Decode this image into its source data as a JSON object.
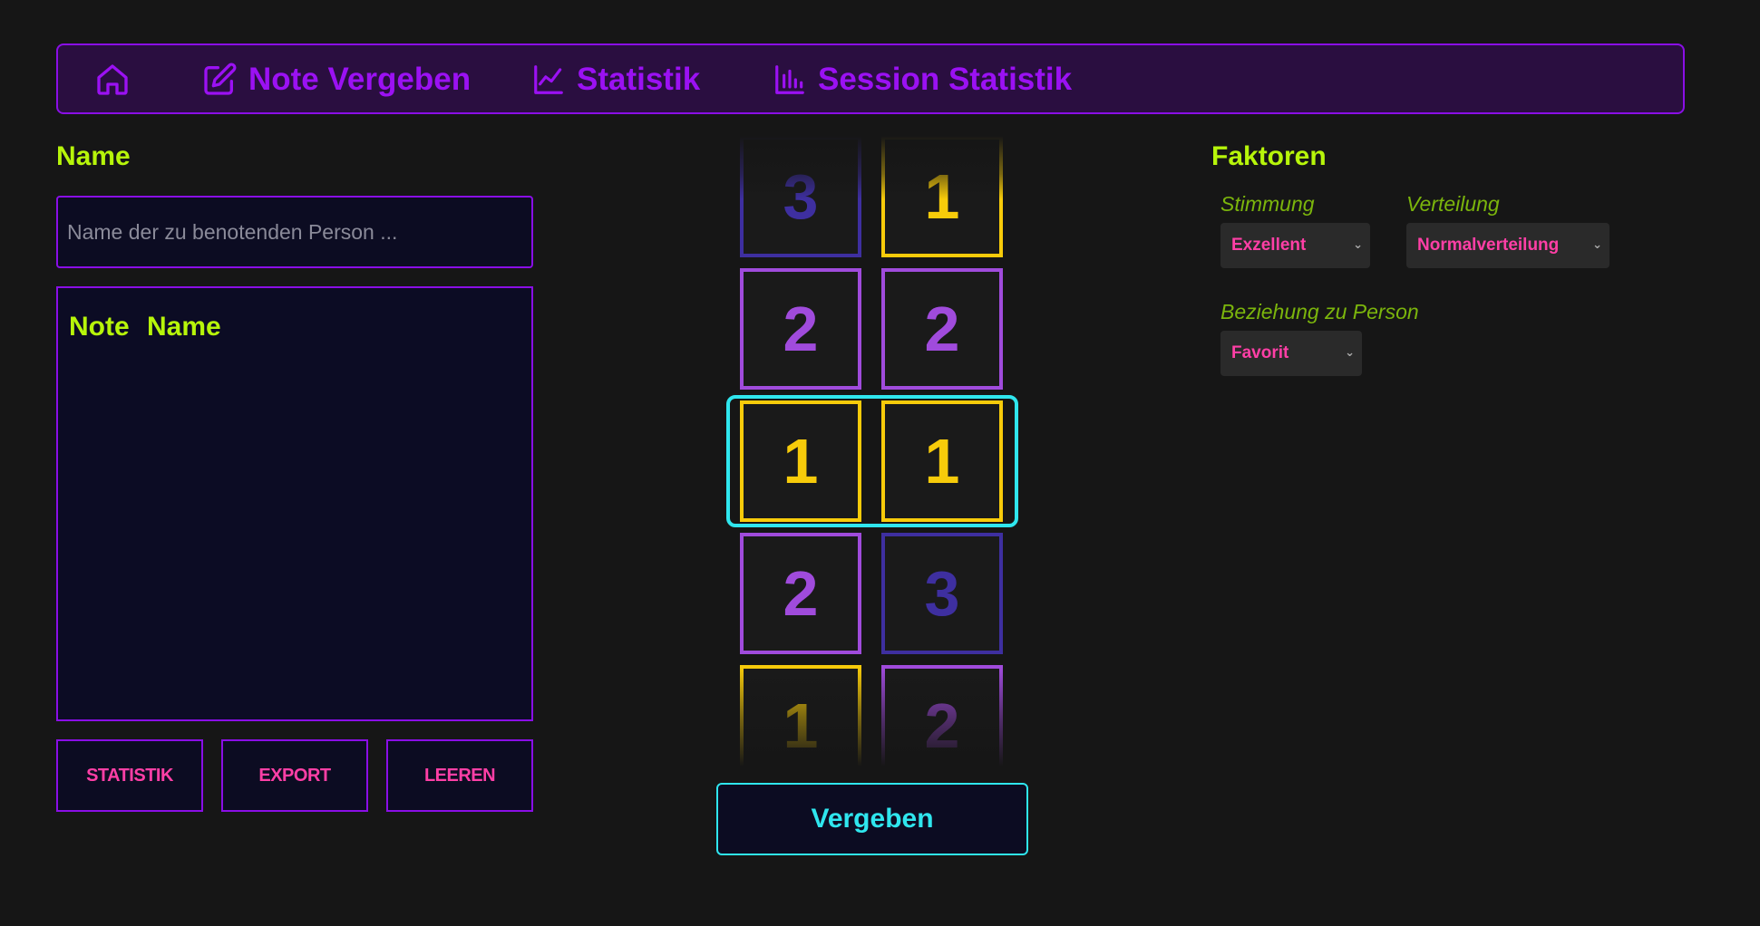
{
  "nav": {
    "items": [
      {
        "label": "",
        "icon": "home-icon"
      },
      {
        "label": "Note Vergeben",
        "icon": "edit-icon"
      },
      {
        "label": "Statistik",
        "icon": "line-chart-icon"
      },
      {
        "label": "Session Statistik",
        "icon": "bar-chart-icon"
      }
    ]
  },
  "left": {
    "heading": "Name",
    "input_placeholder": "Name der zu benotenden Person ...",
    "table_headers": [
      "Note",
      "Name"
    ],
    "buttons": [
      "STATISTIK",
      "EXPORT",
      "LEEREN"
    ]
  },
  "slots": {
    "columns": [
      [
        "3",
        "2",
        "1",
        "2",
        "1"
      ],
      [
        "1",
        "2",
        "1",
        "3",
        "2"
      ]
    ],
    "colors": {
      "1": "#f7cb0a",
      "2": "#a04bdc",
      "3": "#3e2fa0"
    },
    "button": "Vergeben"
  },
  "factors": {
    "heading": "Faktoren",
    "stimmung_label": "Stimmung",
    "stimmung_value": "Exzellent",
    "verteilung_label": "Verteilung",
    "verteilung_value": "Normalverteilung",
    "beziehung_label": "Beziehung zu Person",
    "beziehung_value": "Favorit"
  },
  "colors": {
    "accent_purple": "#8a0ee6",
    "accent_lime": "#b7f50a",
    "accent_pink": "#ff3fa6",
    "accent_cyan": "#2fe6ee"
  }
}
